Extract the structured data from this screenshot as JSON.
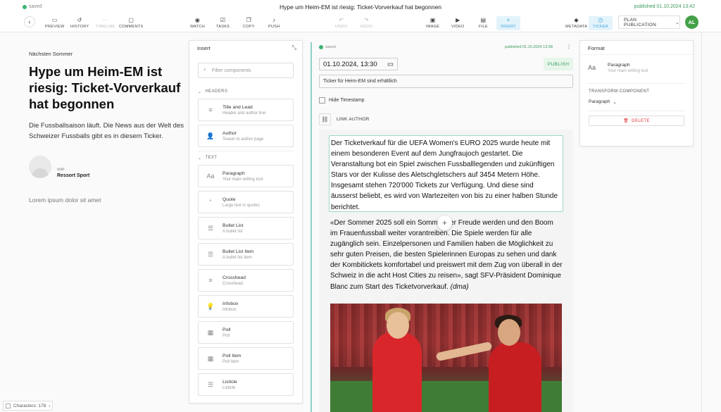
{
  "status": {
    "saved": "saved",
    "title": "Hype um Heim-EM ist riesig: Ticket-Vorverkauf hat begonnen",
    "published": "published 01.10.2024 13:42"
  },
  "toolbar": {
    "back": "‹",
    "preview": "PREVIEW",
    "history": "HISTORY",
    "timeline": "TIMELINE",
    "comments": "COMMENTS",
    "watch": "WATCH",
    "tasks": "TASKS",
    "copy": "COPY",
    "push": "PUSH",
    "undo": "UNDO",
    "redo": "REDO",
    "image": "IMAGE",
    "video": "VIDEO",
    "file": "FILE",
    "insert": "INSERT",
    "metadata": "METADATA",
    "ticker": "TICKER",
    "plan": "PLAN PUBLICATION",
    "avatar": "AL"
  },
  "preview": {
    "kicker": "Nächsten Sommer",
    "headline": "Hype um Heim-EM ist riesig: Ticket-Vorverkauf hat begonnen",
    "lead": "Die Fussballsaison läuft. Die News aus der Welt des Schweizer Fussballs gibt es in diesem Ticker.",
    "author_prefix": "von",
    "author_name": "Ressort Sport",
    "lorem": "Lorem ipsum dolor sit amet"
  },
  "insert_panel": {
    "title": "Insert",
    "filter_placeholder": "Filter components",
    "headers_label": "HEADERS",
    "text_label": "TEXT",
    "headers": [
      {
        "name": "Title and Lead",
        "desc": "Header and author line",
        "icon": "≡"
      },
      {
        "name": "Author",
        "desc": "Teaser to author page",
        "icon": "👤"
      }
    ],
    "text": [
      {
        "name": "Paragraph",
        "desc": "Your main writing tool",
        "icon": "Aa"
      },
      {
        "name": "Quote",
        "desc": "Large text in quotes",
        "icon": "“"
      },
      {
        "name": "Bullet List",
        "desc": "A bullet list",
        "icon": "☰"
      },
      {
        "name": "Bullet List Item",
        "desc": "A bullet list item",
        "icon": "☰"
      },
      {
        "name": "Crosshead",
        "desc": "Crosshead",
        "icon": "≡"
      },
      {
        "name": "Infobox",
        "desc": "Infobox",
        "icon": "💡"
      },
      {
        "name": "Poll",
        "desc": "Poll",
        "icon": "▦"
      },
      {
        "name": "Poll Item",
        "desc": "Poll Item",
        "icon": "▦"
      },
      {
        "name": "Listicle",
        "desc": "Listicle",
        "icon": "☰"
      }
    ]
  },
  "editor": {
    "saved": "saved",
    "published": "published 01.10.2024 13:38",
    "date": "01.10.2024, 13:30",
    "publish": "PUBLISH",
    "ticker_title": "Ticker für Heim-EM sind erhältlich",
    "hide_timestamp": "Hide Timestamp",
    "link_author": "LINK AUTHOR",
    "paragraph1": "Der Ticketverkauf für die UEFA Women's EURO 2025 wurde heute mit einem besonderen Event auf dem Jungfraujoch gestartet. Die Veranstaltung bot ein Spiel zwischen Fussballlegenden und zukünftigen Stars vor der Kulisse des Aletschgletschers auf 3454 Metern Höhe. Insgesamt stehen 720'000 Tickets zur Verfügung. Und diese sind äusserst beliebt, es wird von Wartezeiten von bis zu einer halben Stunde berichtet.",
    "paragraph2": "«Der Sommer 2025 soll ein Sommer der Freude werden und den Boom im Frauenfussball weiter vorantreiben. Die Spiele werden für alle zugänglich sein. Einzelpersonen und Familien haben die Möglichkeit zu sehr guten Preisen, die besten Spielerinnen Europas zu sehen und dank der Kombitickets komfortabel und preiswert mit dem Zug von überall in der Schweiz in die acht Host Cities zu reisen», sagt SFV-Präsident Dominique Blanc zum Start des Ticketvorverkauf.",
    "paragraph2_credit": "(dma)"
  },
  "format_panel": {
    "title": "Format",
    "component_name": "Paragraph",
    "component_desc": "Your main writing tool",
    "component_icon": "Aa",
    "transform_label": "TRANSFORM COMPONENT",
    "transform_value": "Paragraph",
    "delete": "DELETE"
  },
  "footer": {
    "characters": "Characters: 178"
  }
}
